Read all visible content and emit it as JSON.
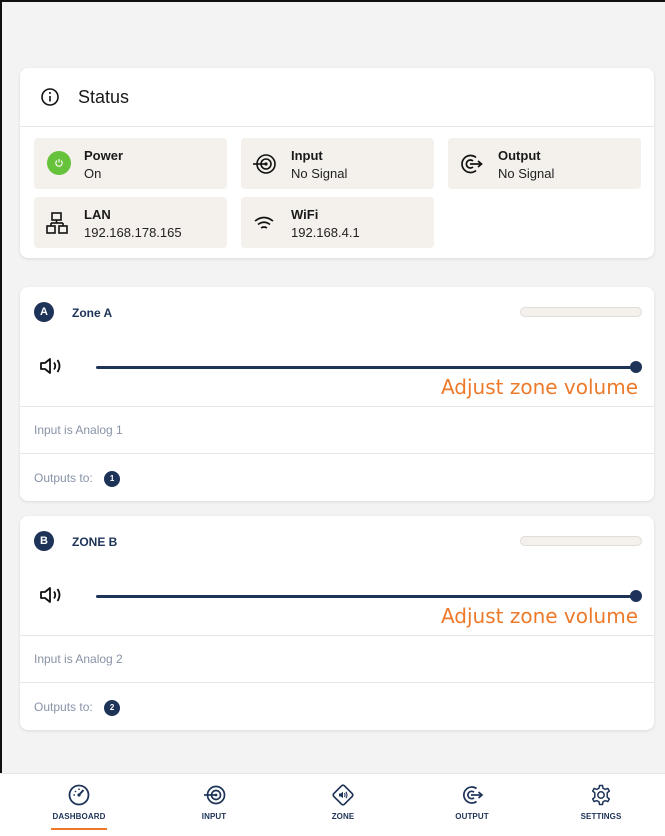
{
  "status": {
    "title": "Status",
    "tiles": [
      {
        "label": "Power",
        "value": "On",
        "icon": "power-icon"
      },
      {
        "label": "Input",
        "value": "No Signal",
        "icon": "input-icon"
      },
      {
        "label": "Output",
        "value": "No Signal",
        "icon": "output-icon"
      },
      {
        "label": "LAN",
        "value": "192.168.178.165",
        "icon": "lan-icon"
      },
      {
        "label": "WiFi",
        "value": "192.168.4.1",
        "icon": "wifi-icon"
      }
    ]
  },
  "zones": [
    {
      "badge": "A",
      "name": "Zone A",
      "volume_hint": "Adjust zone volume",
      "volume_level": 1.0,
      "input_text": "Input is Analog 1",
      "outputs_label": "Outputs to:",
      "outputs": [
        "1"
      ]
    },
    {
      "badge": "B",
      "name": "ZONE B",
      "volume_hint": "Adjust zone volume",
      "volume_level": 1.0,
      "input_text": "Input is Analog 2",
      "outputs_label": "Outputs to:",
      "outputs": [
        "2"
      ]
    }
  ],
  "nav": {
    "items": [
      {
        "label": "DASHBOARD",
        "icon": "dashboard-icon",
        "active": true
      },
      {
        "label": "INPUT",
        "icon": "input-icon",
        "active": false
      },
      {
        "label": "ZONE",
        "icon": "zone-icon",
        "active": false
      },
      {
        "label": "OUTPUT",
        "icon": "output-icon",
        "active": false
      },
      {
        "label": "SETTINGS",
        "icon": "settings-icon",
        "active": false
      }
    ]
  },
  "colors": {
    "primary": "#1e3358",
    "accent": "#ec7a2a",
    "power_on": "#66c23a",
    "tile_bg": "#f4f0ec",
    "muted_text": "#8893a6"
  }
}
